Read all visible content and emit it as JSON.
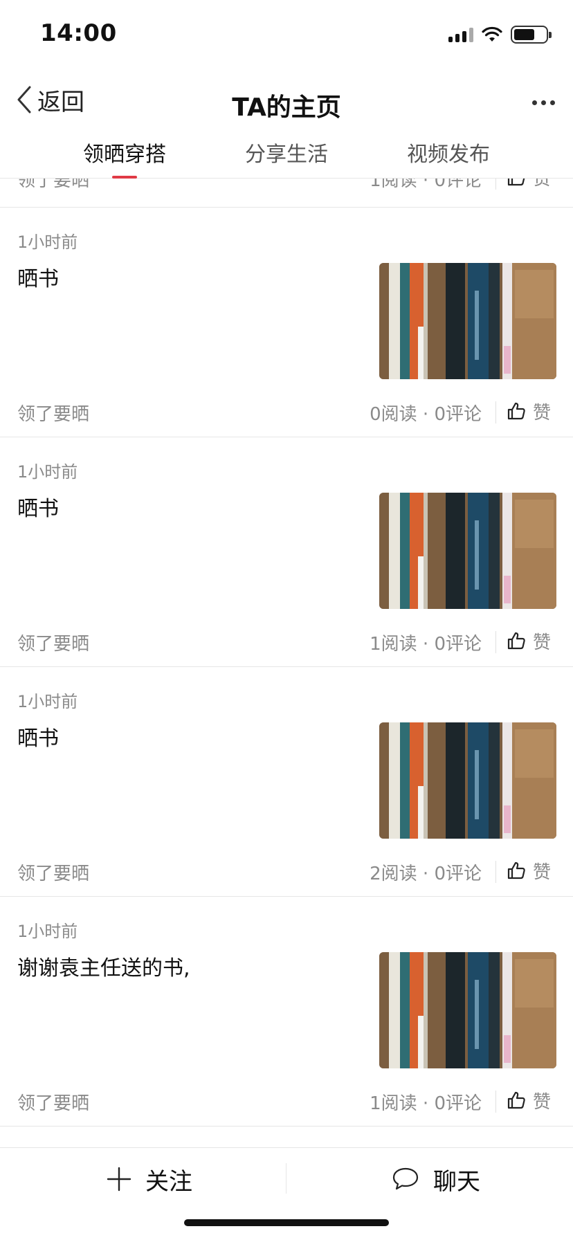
{
  "status_bar": {
    "time": "14:00",
    "icons": [
      "cellular-signal-icon",
      "wifi-icon",
      "battery-icon"
    ],
    "battery_level": 0.65
  },
  "nav": {
    "back_label": "返回",
    "title": "TA的主页",
    "more_icon": "more-dots-icon"
  },
  "tabs": [
    {
      "label": "领晒穿搭",
      "active": true
    },
    {
      "label": "分享生活",
      "active": false
    },
    {
      "label": "视频发布",
      "active": false
    }
  ],
  "accent_color": "#e03a45",
  "partial_post": {
    "tag": "领了要晒",
    "stats": "1阅读 · 0评论",
    "like_label": "赞"
  },
  "posts": [
    {
      "time": "1小时前",
      "text": "晒书",
      "tag": "领了要晒",
      "stats": "0阅读 · 0评论",
      "like_label": "赞"
    },
    {
      "time": "1小时前",
      "text": "晒书",
      "tag": "领了要晒",
      "stats": "1阅读 · 0评论",
      "like_label": "赞"
    },
    {
      "time": "1小时前",
      "text": "晒书",
      "tag": "领了要晒",
      "stats": "2阅读 · 0评论",
      "like_label": "赞"
    },
    {
      "time": "1小时前",
      "text": "谢谢袁主任送的书,",
      "tag": "领了要晒",
      "stats": "1阅读 · 0评论",
      "like_label": "赞"
    }
  ],
  "bottom_bar": {
    "follow_label": "关注",
    "follow_icon": "plus-icon",
    "chat_label": "聊天",
    "chat_icon": "chat-bubble-icon"
  }
}
